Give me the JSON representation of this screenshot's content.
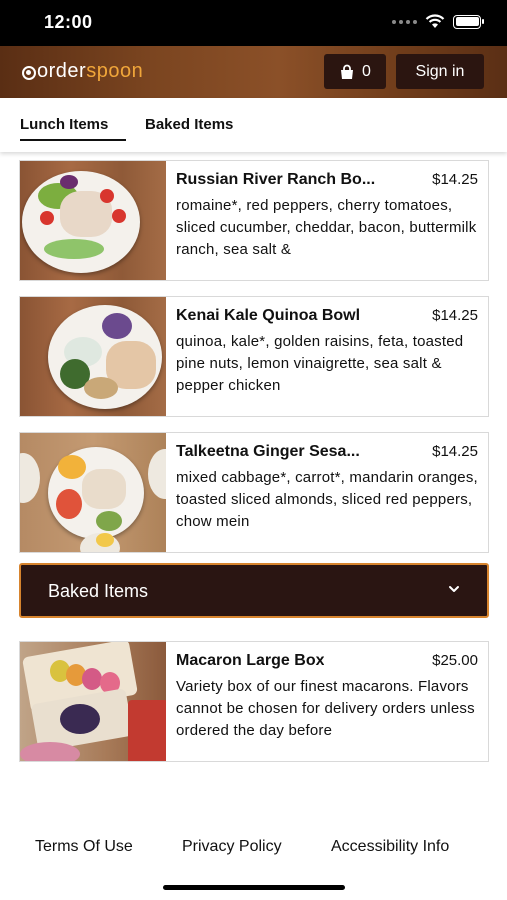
{
  "status_bar": {
    "time": "12:00",
    "icons": [
      "cellular-dots-icon",
      "wifi-icon",
      "battery-icon"
    ]
  },
  "header": {
    "logo_part1": "order",
    "logo_part2": "spoon",
    "cart_count": "0",
    "signin_label": "Sign in",
    "colors": {
      "brand_orange": "#f0a63a",
      "button_bg": "#2b1510"
    }
  },
  "tabs": [
    {
      "label": "Lunch Items",
      "active": true
    },
    {
      "label": "Baked Items",
      "active": false
    }
  ],
  "lunch_items": [
    {
      "title": "Russian River Ranch Bo...",
      "price": "$14.25",
      "description": "romaine*, red peppers, cherry tomatoes, sliced cucumber, cheddar, bacon, buttermilk ranch, sea salt &"
    },
    {
      "title": "Kenai Kale Quinoa Bowl",
      "price": "$14.25",
      "description": "quinoa, kale*, golden raisins, feta, toasted pine nuts, lemon vinaigrette, sea salt & pepper chicken"
    },
    {
      "title": "Talkeetna Ginger Sesa...",
      "price": "$14.25",
      "description": "mixed cabbage*, carrot*, mandarin oranges, toasted sliced almonds, sliced red peppers, chow mein"
    }
  ],
  "baked_section": {
    "label": "Baked Items",
    "chevron": "chevron-down-icon",
    "color": "#2a1512",
    "border_color": "#d7842e"
  },
  "baked_items": [
    {
      "title": "Macaron Large Box",
      "price": "$25.00",
      "description": "Variety box of our finest macarons. Flavors cannot be chosen for delivery orders unless ordered the day before"
    }
  ],
  "footer": {
    "terms": "Terms Of Use",
    "privacy": "Privacy Policy",
    "accessibility": "Accessibility Info"
  }
}
